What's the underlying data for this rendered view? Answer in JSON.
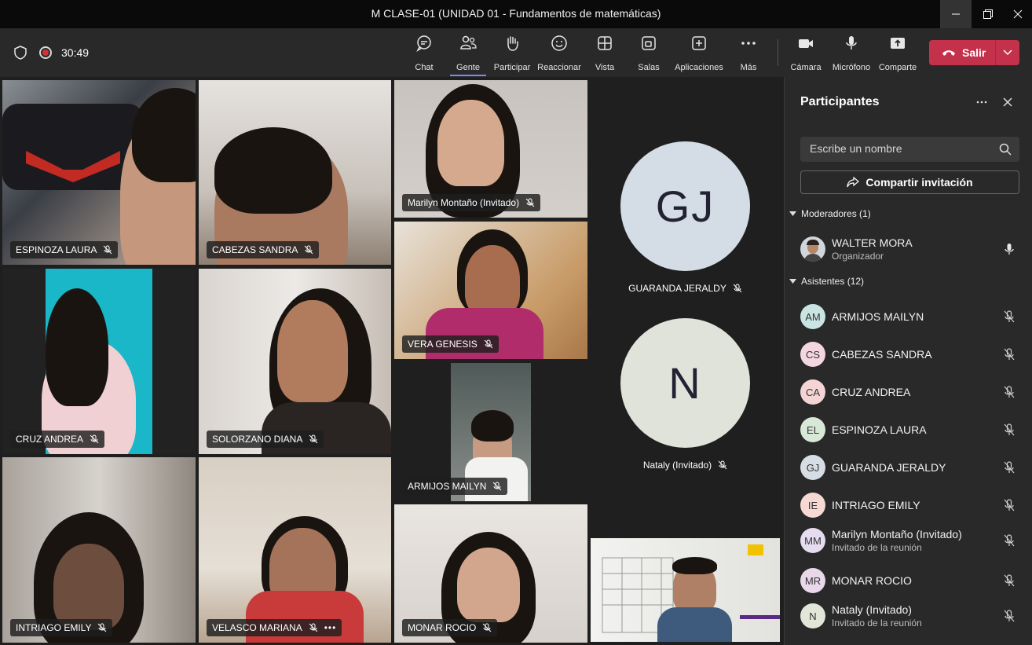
{
  "window": {
    "title": "M CLASE-01 (UNIDAD 01 - Fundamentos de matemáticas)"
  },
  "toolbar": {
    "timer": "30:49",
    "buttons": [
      {
        "label": "Chat",
        "icon": "chat-icon"
      },
      {
        "label": "Gente",
        "icon": "people-icon"
      },
      {
        "label": "Participar",
        "icon": "raise-hand-icon"
      },
      {
        "label": "Reaccionar",
        "icon": "smiley-icon"
      },
      {
        "label": "Vista",
        "icon": "grid-view-icon"
      },
      {
        "label": "Salas",
        "icon": "breakout-rooms-icon"
      },
      {
        "label": "Aplicaciones",
        "icon": "add-apps-icon"
      },
      {
        "label": "Más",
        "icon": "more-icon"
      },
      {
        "label": "Cámara",
        "icon": "camera-icon"
      },
      {
        "label": "Micrófono",
        "icon": "microphone-icon"
      },
      {
        "label": "Comparte",
        "icon": "share-icon"
      }
    ],
    "leave_label": "Salir",
    "accent": "#c4314b"
  },
  "tiles": [
    {
      "name": "ESPINOZA LAURA"
    },
    {
      "name": "CABEZAS SANDRA"
    },
    {
      "name": "Marilyn Montaño (Invitado)"
    },
    {
      "name": "CRUZ ANDREA"
    },
    {
      "name": "SOLORZANO DIANA"
    },
    {
      "name": "VERA GENESIS"
    },
    {
      "name": "ARMIJOS MAILYN"
    },
    {
      "name": "INTRIAGO EMILY"
    },
    {
      "name": "VELASCO MARIANA"
    },
    {
      "name": "MONAR ROCIO"
    }
  ],
  "avatar_tiles": [
    {
      "initials": "GJ",
      "name": "GUARANDA JERALDY"
    },
    {
      "initials": "N",
      "name": "Nataly (Invitado)"
    }
  ],
  "panel": {
    "title": "Participantes",
    "search_placeholder": "Escribe un nombre",
    "invite_label": "Compartir invitación",
    "moderators_header": "Moderadores (1)",
    "moderator": {
      "name": "WALTER MORA",
      "role": "Organizador"
    },
    "attendees_header": "Asistentes (12)",
    "attendees": [
      {
        "initials": "AM",
        "name": "ARMIJOS MAILYN",
        "sub": ""
      },
      {
        "initials": "CS",
        "name": "CABEZAS SANDRA",
        "sub": ""
      },
      {
        "initials": "CA",
        "name": "CRUZ ANDREA",
        "sub": ""
      },
      {
        "initials": "EL",
        "name": "ESPINOZA LAURA",
        "sub": ""
      },
      {
        "initials": "GJ",
        "name": "GUARANDA JERALDY",
        "sub": ""
      },
      {
        "initials": "IE",
        "name": "INTRIAGO EMILY",
        "sub": ""
      },
      {
        "initials": "MM",
        "name": "Marilyn Montaño (Invitado)",
        "sub": "Invitado de la reunión"
      },
      {
        "initials": "MR",
        "name": "MONAR ROCIO",
        "sub": ""
      },
      {
        "initials": "N",
        "name": "Nataly (Invitado)",
        "sub": "Invitado de la reunión"
      }
    ]
  }
}
